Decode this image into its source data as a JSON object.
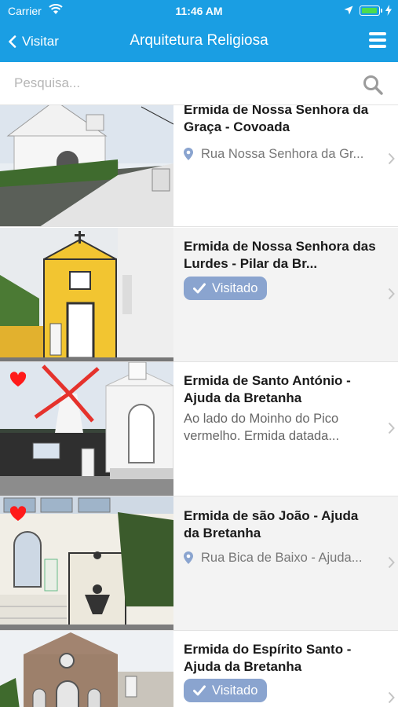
{
  "status": {
    "carrier": "Carrier",
    "time": "11:46 AM",
    "battery_level": 0.95,
    "icons": [
      "wifi-icon",
      "location-arrow-icon",
      "battery-icon",
      "charging-bolt-icon"
    ]
  },
  "nav": {
    "back_label": "Visitar",
    "title": "Arquitetura Religiosa",
    "menu_icon": "hamburger-menu-icon"
  },
  "search": {
    "placeholder": "Pesquisa...",
    "value": "",
    "icon": "search-icon"
  },
  "colors": {
    "accent": "#1a9ee3",
    "badge": "#8aa4cf",
    "heart": "#ff1a1a"
  },
  "items": [
    {
      "title": "Ermida de Nossa Senhora da Graça - Covoada",
      "address": "Rua Nossa Senhora da Gr...",
      "favorite": false,
      "visited": false
    },
    {
      "title": "Ermida de Nossa Senhora das Lurdes - Pilar da Br...",
      "favorite": false,
      "visited": true,
      "visited_label": "Visitado"
    },
    {
      "title": "Ermida de Santo António - Ajuda da Bretanha",
      "description": "Ao lado do Moinho do Pico vermelho. Ermida datada...",
      "favorite": true,
      "visited": false
    },
    {
      "title": "Ermida de são João - Ajuda da Bretanha",
      "address": "Rua Bica de Baixo - Ajuda...",
      "favorite": true,
      "visited": false
    },
    {
      "title": "Ermida do Espírito Santo - Ajuda da Bretanha",
      "favorite": false,
      "visited": true,
      "visited_label": "Visitado"
    }
  ]
}
